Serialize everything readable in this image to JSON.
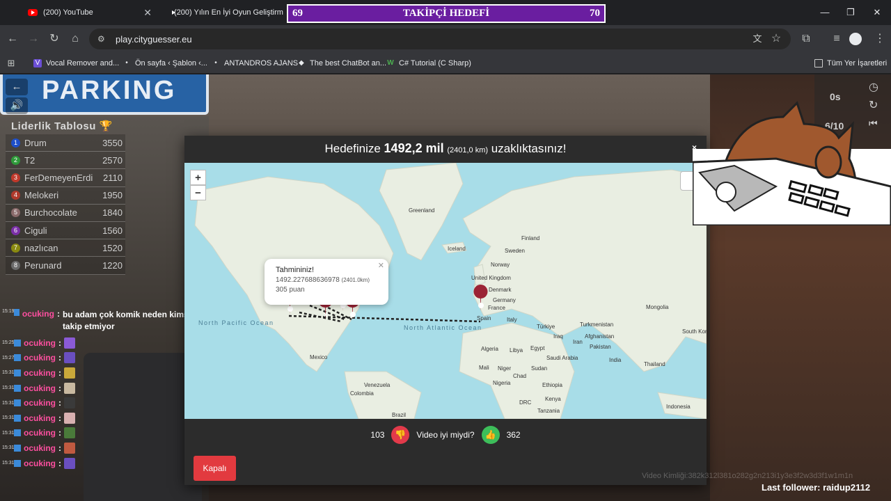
{
  "tabs": [
    {
      "title": "(200) YouTube"
    },
    {
      "title": "(200) Yılın En İyi Oyun Geliştirm"
    }
  ],
  "goal_bar": {
    "left": "69",
    "title": "TAKİPÇİ HEDEFİ",
    "right": "70"
  },
  "address": {
    "url": "play.cityguesser.eu"
  },
  "bookmarks": [
    {
      "label": "Vocal Remover and...",
      "icon": "V"
    },
    {
      "label": "Ön sayfa ‹ Şablon ‹...",
      "icon": "•"
    },
    {
      "label": "ANTANDROS AJANS",
      "icon": "•"
    },
    {
      "label": "The best ChatBot an...",
      "icon": "◆"
    },
    {
      "label": "C# Tutorial (C Sharp)",
      "icon": "W"
    }
  ],
  "bookmarks_folder": {
    "label": "Tüm Yer İşaretleri"
  },
  "background": {
    "sign_text": "PARKING"
  },
  "leaderboard": {
    "title": "Liderlik Tablosu",
    "rows": [
      {
        "rank": "1",
        "name": "Drum",
        "score": "3550",
        "color": "#1e4fc9"
      },
      {
        "rank": "2",
        "name": "T2",
        "score": "2570",
        "color": "#2e9a3a"
      },
      {
        "rank": "3",
        "name": "FerDemeyenErdi",
        "score": "2110",
        "color": "#c0392b"
      },
      {
        "rank": "4",
        "name": "Melokeri",
        "score": "1950",
        "color": "#b0392b"
      },
      {
        "rank": "5",
        "name": "Burchocolate",
        "score": "1840",
        "color": "#8a6a6a"
      },
      {
        "rank": "6",
        "name": "Ciguli",
        "score": "1560",
        "color": "#7b2fa8"
      },
      {
        "rank": "7",
        "name": "nazlıcan",
        "score": "1520",
        "color": "#8a8a10"
      },
      {
        "rank": "8",
        "name": "Perunard",
        "score": "1220",
        "color": "#6a6a6a"
      }
    ]
  },
  "game_right": {
    "timer": "0s",
    "round": "6/10"
  },
  "chat": [
    {
      "time": "15:19",
      "user": "ocuking",
      "msg": "bu adam çok komik neden kimse takip etmiyor"
    },
    {
      "time": "15:25",
      "user": "ocuking",
      "msg": ""
    },
    {
      "time": "15:27",
      "user": "ocuking",
      "msg": ""
    },
    {
      "time": "15:31",
      "user": "ocuking",
      "msg": ""
    },
    {
      "time": "15:31",
      "user": "ocuking",
      "msg": ""
    },
    {
      "time": "15:31",
      "user": "ocuking",
      "msg": ""
    },
    {
      "time": "15:31",
      "user": "ocuking",
      "msg": ""
    },
    {
      "time": "15:31",
      "user": "ocuking",
      "msg": ""
    },
    {
      "time": "15:31",
      "user": "ocuking",
      "msg": ""
    },
    {
      "time": "15:31",
      "user": "ocuking",
      "msg": ""
    }
  ],
  "modal": {
    "title_prefix": "Hedefinize",
    "distance_mi": "1492,2 mil",
    "distance_km": "(2401,0 km)",
    "title_suffix": "uzaklıktasınız!",
    "close": "×",
    "vote_down_count": "103",
    "vote_question": "Video iyi miydi?",
    "vote_up_count": "362",
    "close_button": "Kapalı"
  },
  "popup": {
    "title": "Tahmininiz!",
    "distance": "1492.227688636978",
    "distance_km": "(2401.0km)",
    "points": "305 puan"
  },
  "map_labels": {
    "greenland": "Greenland",
    "iceland": "Iceland",
    "finland": "Finland",
    "sweden": "Sweden",
    "norway": "Norway",
    "uk": "United Kingdom",
    "denmark": "Denmark",
    "germany": "Germany",
    "france": "France",
    "spain": "Spain",
    "italy": "Italy",
    "mongolia": "Mongolia",
    "turkiye": "Türkiye",
    "turkmenistan": "Turkmenistan",
    "iran": "Iran",
    "iraq": "Iraq",
    "afghanistan": "Afghanistan",
    "pakistan": "Pakistan",
    "india": "India",
    "thailand": "Thailand",
    "south_korea": "South Kore",
    "algeria": "Algeria",
    "libya": "Libya",
    "egypt": "Egypt",
    "saudi": "Saudi Arabia",
    "mali": "Mali",
    "niger": "Niger",
    "chad": "Chad",
    "sudan": "Sudan",
    "nigeria": "Nigeria",
    "ethiopia": "Ethiopia",
    "drc": "DRC",
    "kenya": "Kenya",
    "tanzania": "Tanzania",
    "indonesia": "Indonesia",
    "mexico": "Mexico",
    "venezuela": "Venezuela",
    "colombia": "Colombia",
    "brazil": "Brazil",
    "north_pacific": "North Pacific Ocean",
    "north_atlantic": "North Atlantic Ocean"
  },
  "footer": {
    "last_follower": "Last follower: raidup2112",
    "video_id": "Video Kimliği:382k312l381o282g2n213i1y3e3f2w3d3f1w1m1n"
  }
}
